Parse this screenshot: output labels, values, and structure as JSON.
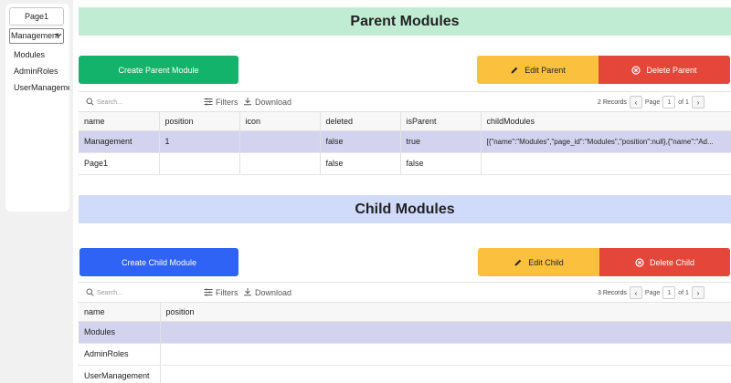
{
  "sidebar": {
    "page_label": "Page1",
    "app_select": "Management",
    "items": [
      {
        "label": "Modules"
      },
      {
        "label": "AdminRoles"
      },
      {
        "label": "UserManagement"
      }
    ]
  },
  "parent": {
    "title": "Parent Modules",
    "create_label": "Create Parent Module",
    "edit_label": "Edit Parent",
    "delete_label": "Delete Parent",
    "search_placeholder": "Search...",
    "filters_label": "Filters",
    "download_label": "Download",
    "records": "2 Records",
    "page_label": "Page",
    "page_value": "1",
    "of_label": "of 1",
    "columns": [
      "name",
      "position",
      "icon",
      "deleted",
      "isParent",
      "childModules"
    ],
    "rows": [
      [
        "Management",
        "1",
        "",
        "false",
        "true",
        "[{\"name\":\"Modules\",\"page_id\":\"Modules\",\"position\":null},{\"name\":\"Ad..."
      ],
      [
        "Page1",
        "",
        "",
        "false",
        "false",
        ""
      ]
    ]
  },
  "child": {
    "title": "Child Modules",
    "create_label": "Create Child Module",
    "edit_label": "Edit Child",
    "delete_label": "Delete Child",
    "search_placeholder": "Search...",
    "filters_label": "Filters",
    "download_label": "Download",
    "records": "3 Records",
    "page_label": "Page",
    "page_value": "1",
    "of_label": "of 1",
    "columns": [
      "name",
      "position"
    ],
    "rows": [
      [
        "Modules",
        ""
      ],
      [
        "AdminRoles",
        ""
      ],
      [
        "UserManagement",
        ""
      ]
    ]
  },
  "colors": {
    "parent_banner": "#c1ecd4",
    "child_banner": "#d0dbfb",
    "create_parent": "#14b36c",
    "create_child": "#2f63f5",
    "edit": "#fbc13e",
    "delete": "#e4463a",
    "selected_row": "#d3d3f0"
  }
}
